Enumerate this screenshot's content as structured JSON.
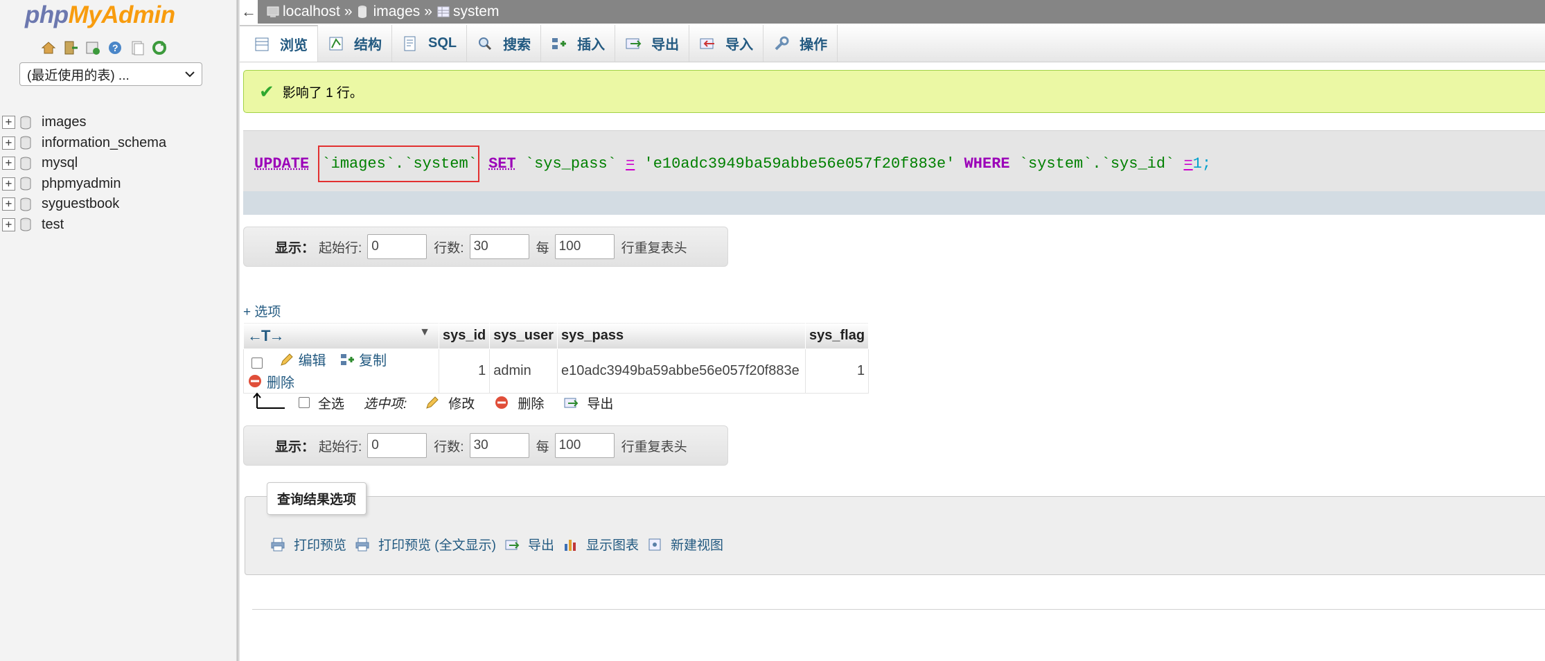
{
  "logo": {
    "php": "php",
    "my": "My",
    "admin": "Admin"
  },
  "nav": {
    "recent_select": "(最近使用的表) ...",
    "databases": [
      "images",
      "information_schema",
      "mysql",
      "phpmyadmin",
      "syguestbook",
      "test"
    ]
  },
  "breadcrumb": {
    "server": "localhost",
    "database": "images",
    "table": "system",
    "separator": "»"
  },
  "tabs": [
    "浏览",
    "结构",
    "SQL",
    "搜索",
    "插入",
    "导出",
    "导入",
    "操作"
  ],
  "success_message": "影响了 1 行。",
  "sql": {
    "update": "UPDATE",
    "table_ref": "`images`.`system`",
    "set": "SET",
    "column": "`sys_pass`",
    "eq": "=",
    "value": "'e10adc3949ba59abbe56e057f20f883e'",
    "where": "WHERE",
    "where_col": "`system`.`sys_id`",
    "eq2": "=",
    "where_val": "1",
    "end": ";"
  },
  "navigation": {
    "show_label": "显示：",
    "start_label": "起始行:",
    "start_value": "0",
    "rows_label": "行数:",
    "rows_value": "30",
    "every_label": "每",
    "every_value": "100",
    "repeat_header": "行重复表头"
  },
  "options_link": "+ 选项",
  "table": {
    "arrows": "←T→",
    "columns": [
      "sys_id",
      "sys_user",
      "sys_pass",
      "sys_flag"
    ],
    "rows": [
      {
        "edit": "编辑",
        "copy": "复制",
        "delete": "删除",
        "sys_id": "1",
        "sys_user": "admin",
        "sys_pass": "e10adc3949ba59abbe56e057f20f883e",
        "sys_flag": "1"
      }
    ]
  },
  "bulk": {
    "select_all": "全选",
    "with_selected": "选中项:",
    "modify": "修改",
    "delete": "删除",
    "export": "导出"
  },
  "query_results": {
    "legend": "查询结果选项",
    "actions": [
      "打印预览",
      "打印预览 (全文显示)",
      "导出",
      "显示图表",
      "新建视图"
    ]
  }
}
